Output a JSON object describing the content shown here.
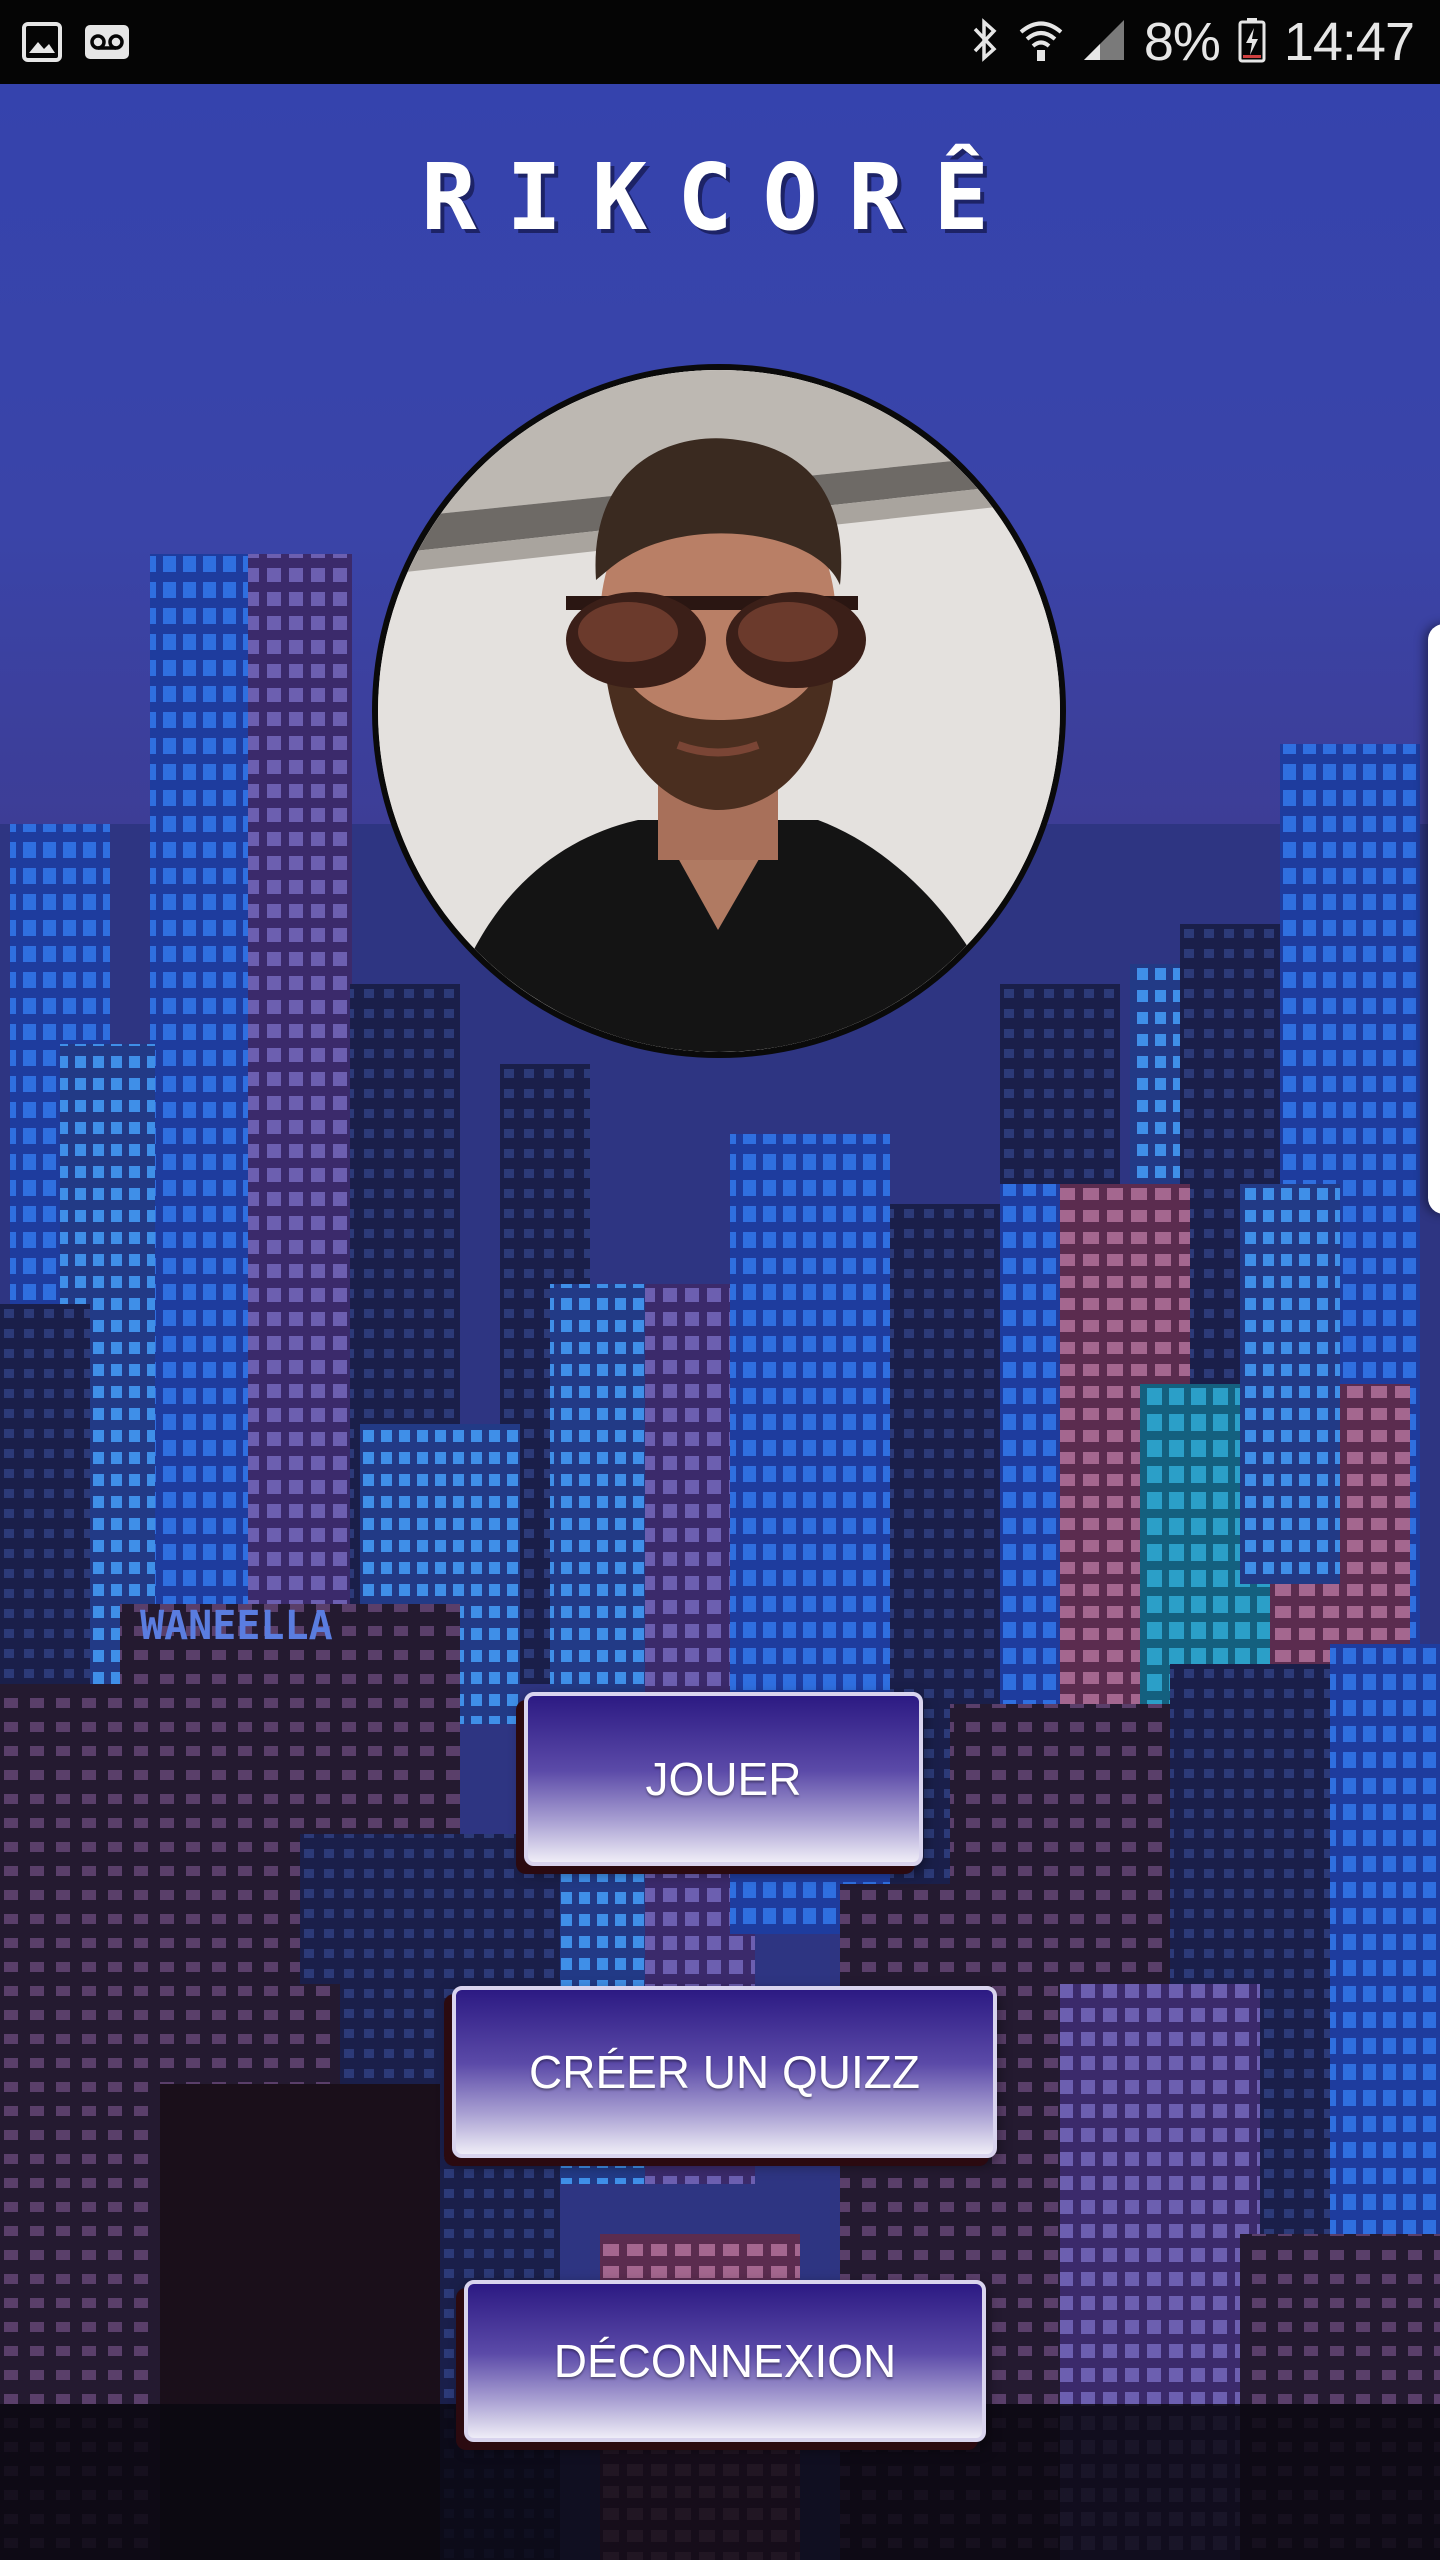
{
  "status_bar": {
    "battery_percent": "8%",
    "time": "14:47",
    "left_icons": [
      "image-icon",
      "voicemail-icon"
    ],
    "right_icons": [
      "bluetooth-icon",
      "wifi-icon",
      "signal-icon",
      "battery-charging-icon"
    ]
  },
  "app": {
    "title": "RIKCORÊ",
    "billboard_text": "WANEELLA"
  },
  "menu": {
    "play_label": "JOUER",
    "create_quiz_label": "CRÉER UN QUIZZ",
    "logout_label": "DÉCONNEXION"
  },
  "colors": {
    "sky_top": "#3543ad",
    "button_top": "#2c1a83",
    "button_bottom": "#efedf7",
    "status_bar_bg": "#050505"
  }
}
